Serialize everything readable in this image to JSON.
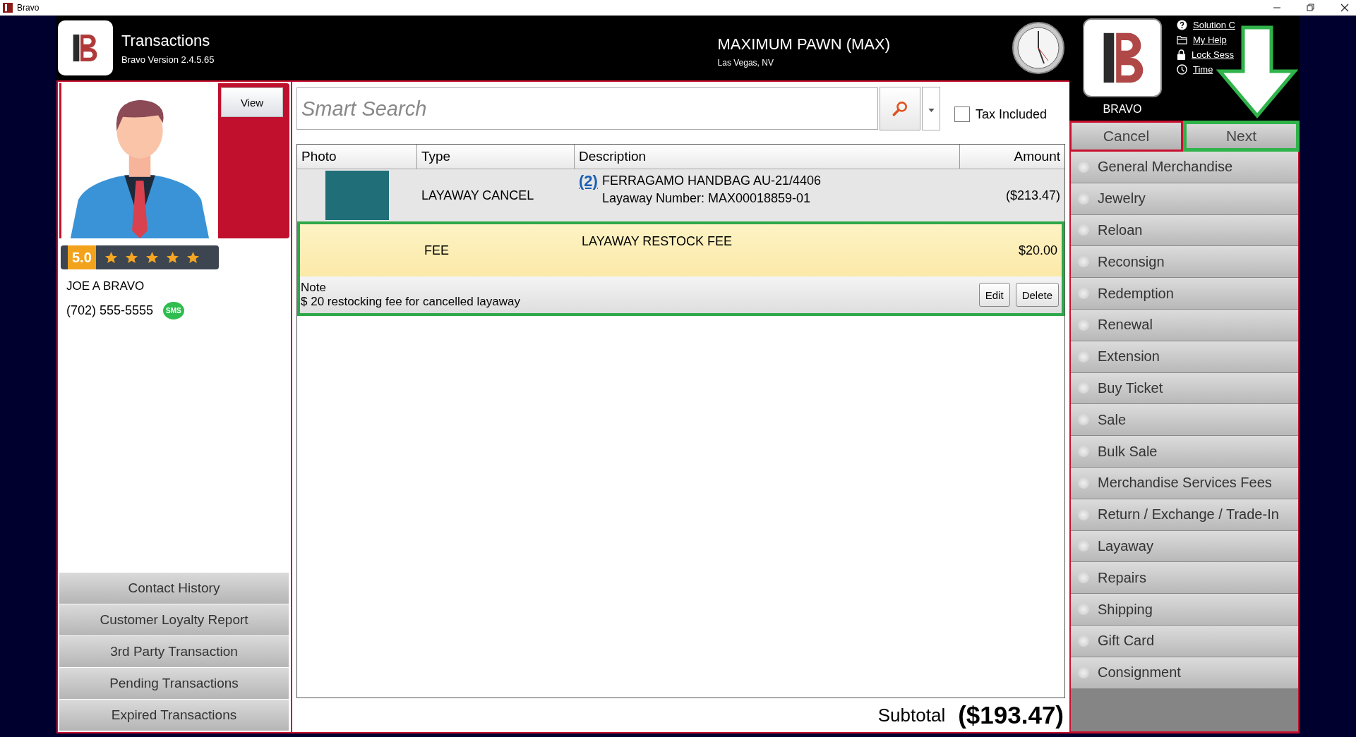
{
  "window": {
    "title": "Bravo"
  },
  "header": {
    "title": "Transactions",
    "version": "Bravo Version 2.4.5.65",
    "store": "MAXIMUM PAWN (MAX)",
    "location": "Las Vegas, NV",
    "user": "BRAVO",
    "links": [
      {
        "label": "Solution C",
        "kind": "help"
      },
      {
        "label": "My Help",
        "kind": "folder"
      },
      {
        "label": "Lock Sess",
        "kind": "lock"
      },
      {
        "label": "Time",
        "kind": "clock"
      }
    ]
  },
  "customer": {
    "view": "View",
    "rating": "5.0",
    "stars": 5,
    "name": "JOE A BRAVO",
    "phone": "(702) 555-5555",
    "sms": "SMS",
    "actions": [
      "Contact History",
      "Customer Loyalty Report",
      "3rd Party Transaction",
      "Pending Transactions",
      "Expired Transactions"
    ]
  },
  "search": {
    "placeholder": "Smart Search",
    "tax_included": {
      "label": "Tax Included",
      "checked": false
    }
  },
  "table": {
    "columns": [
      "Photo",
      "Type",
      "Description",
      "Amount"
    ],
    "rows": [
      {
        "kind": "item",
        "selected": false,
        "type": "LAYAWAY CANCEL",
        "count": "(2)",
        "description": "FERRAGAMO HANDBAG AU-21/4406",
        "detail": "Layaway Number: MAX00018859-01",
        "amount": "($213.47)"
      },
      {
        "kind": "fee",
        "selected": true,
        "type": "FEE",
        "description": "LAYAWAY RESTOCK FEE",
        "amount": "$20.00",
        "note_label": "Note",
        "note": "$ 20 restocking fee for cancelled layaway",
        "buttons": [
          "Edit",
          "Delete"
        ]
      }
    ]
  },
  "subtotal": {
    "label": "Subtotal",
    "value": "($193.47)"
  },
  "actions": {
    "cancel": {
      "label": "Cancel",
      "highlighted": false
    },
    "next": {
      "label": "Next",
      "highlighted": true
    }
  },
  "transaction_types": [
    {
      "label": "General Merchandise",
      "selected": false
    },
    {
      "label": "Jewelry",
      "selected": false
    },
    {
      "label": "Reloan",
      "selected": false
    },
    {
      "label": "Reconsign",
      "selected": false
    },
    {
      "label": "Redemption",
      "selected": false
    },
    {
      "label": "Renewal",
      "selected": false
    },
    {
      "label": "Extension",
      "selected": false
    },
    {
      "label": "Buy Ticket",
      "selected": false
    },
    {
      "label": "Sale",
      "selected": false
    },
    {
      "label": "Bulk Sale",
      "selected": false
    },
    {
      "label": "Merchandise Services Fees",
      "selected": false
    },
    {
      "label": "Return / Exchange / Trade-In",
      "selected": false
    },
    {
      "label": "Layaway",
      "selected": false
    },
    {
      "label": "Repairs",
      "selected": false
    },
    {
      "label": "Shipping",
      "selected": false
    },
    {
      "label": "Gift Card",
      "selected": false
    },
    {
      "label": "Consignment",
      "selected": false
    }
  ]
}
